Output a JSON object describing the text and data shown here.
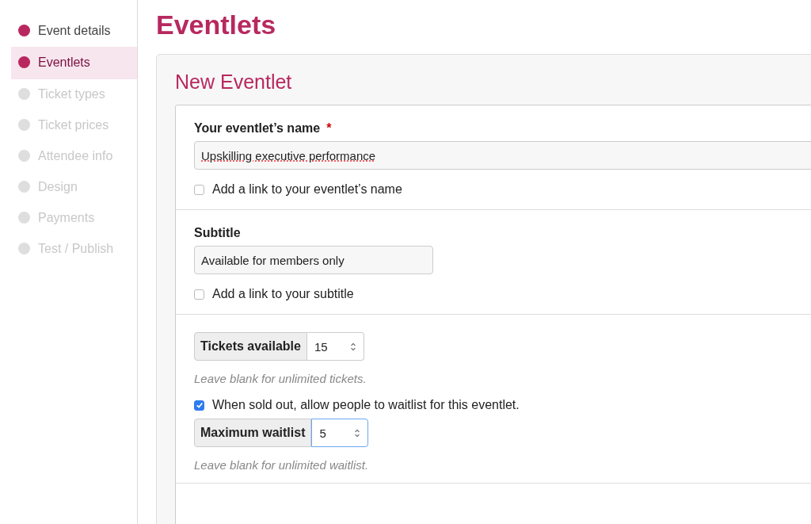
{
  "sidebar": {
    "items": [
      {
        "label": "Event details",
        "selected": false,
        "disabled": false
      },
      {
        "label": "Eventlets",
        "selected": true,
        "disabled": false
      },
      {
        "label": "Ticket types",
        "selected": false,
        "disabled": true
      },
      {
        "label": "Ticket prices",
        "selected": false,
        "disabled": true
      },
      {
        "label": "Attendee info",
        "selected": false,
        "disabled": true
      },
      {
        "label": "Design",
        "selected": false,
        "disabled": true
      },
      {
        "label": "Payments",
        "selected": false,
        "disabled": true
      },
      {
        "label": "Test / Publish",
        "selected": false,
        "disabled": true
      }
    ]
  },
  "page_title": "Eventlets",
  "panel": {
    "title": "New Eventlet",
    "name_section": {
      "label": "Your eventlet’s name",
      "required_mark": "*",
      "value": "Upskilling executive performance",
      "link_option": {
        "label": "Add a link to your eventlet’s name",
        "checked": false
      }
    },
    "subtitle_section": {
      "label": "Subtitle",
      "value": "Available for members only",
      "link_option": {
        "label": "Add a link to your subtitle",
        "checked": false
      }
    },
    "capacity_section": {
      "tickets": {
        "label": "Tickets available",
        "value": "15",
        "focused": false
      },
      "tickets_hint": "Leave blank for unlimited tickets.",
      "waitlist_option": {
        "label": "When sold out, allow people to waitlist for this eventlet.",
        "checked": true
      },
      "waitlist": {
        "label": "Maximum waitlist",
        "value": "5",
        "focused": true
      },
      "waitlist_hint": "Leave blank for unlimited waitlist."
    }
  }
}
